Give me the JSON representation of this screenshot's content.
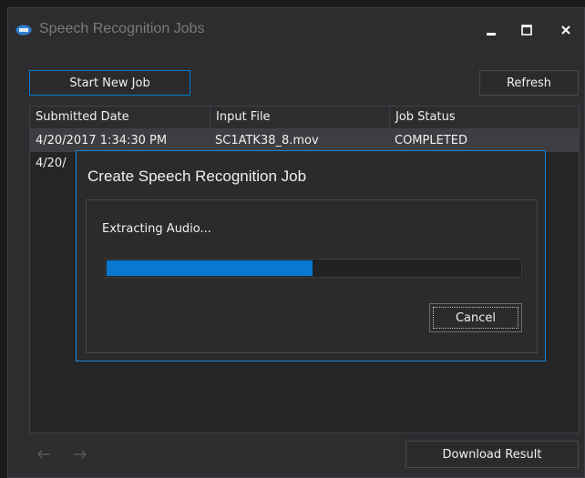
{
  "window": {
    "title": "Speech Recognition Jobs"
  },
  "toolbar": {
    "start_label": "Start New Job",
    "refresh_label": "Refresh"
  },
  "table": {
    "columns": [
      "Submitted Date",
      "Input File",
      "Job Status"
    ],
    "rows": [
      [
        "4/20/2017 1:34:30 PM",
        "SC1ATK38_8.mov",
        "COMPLETED"
      ],
      [
        "4/20/",
        "",
        ""
      ]
    ]
  },
  "footer": {
    "download_label": "Download Result"
  },
  "dialog": {
    "title": "Create Speech Recognition Job",
    "status": "Extracting Audio...",
    "progress": 0.5,
    "cancel_label": "Cancel"
  },
  "colors": {
    "accent": "#007acc",
    "progress": "#0a78d1",
    "background": "#2d2d30"
  }
}
